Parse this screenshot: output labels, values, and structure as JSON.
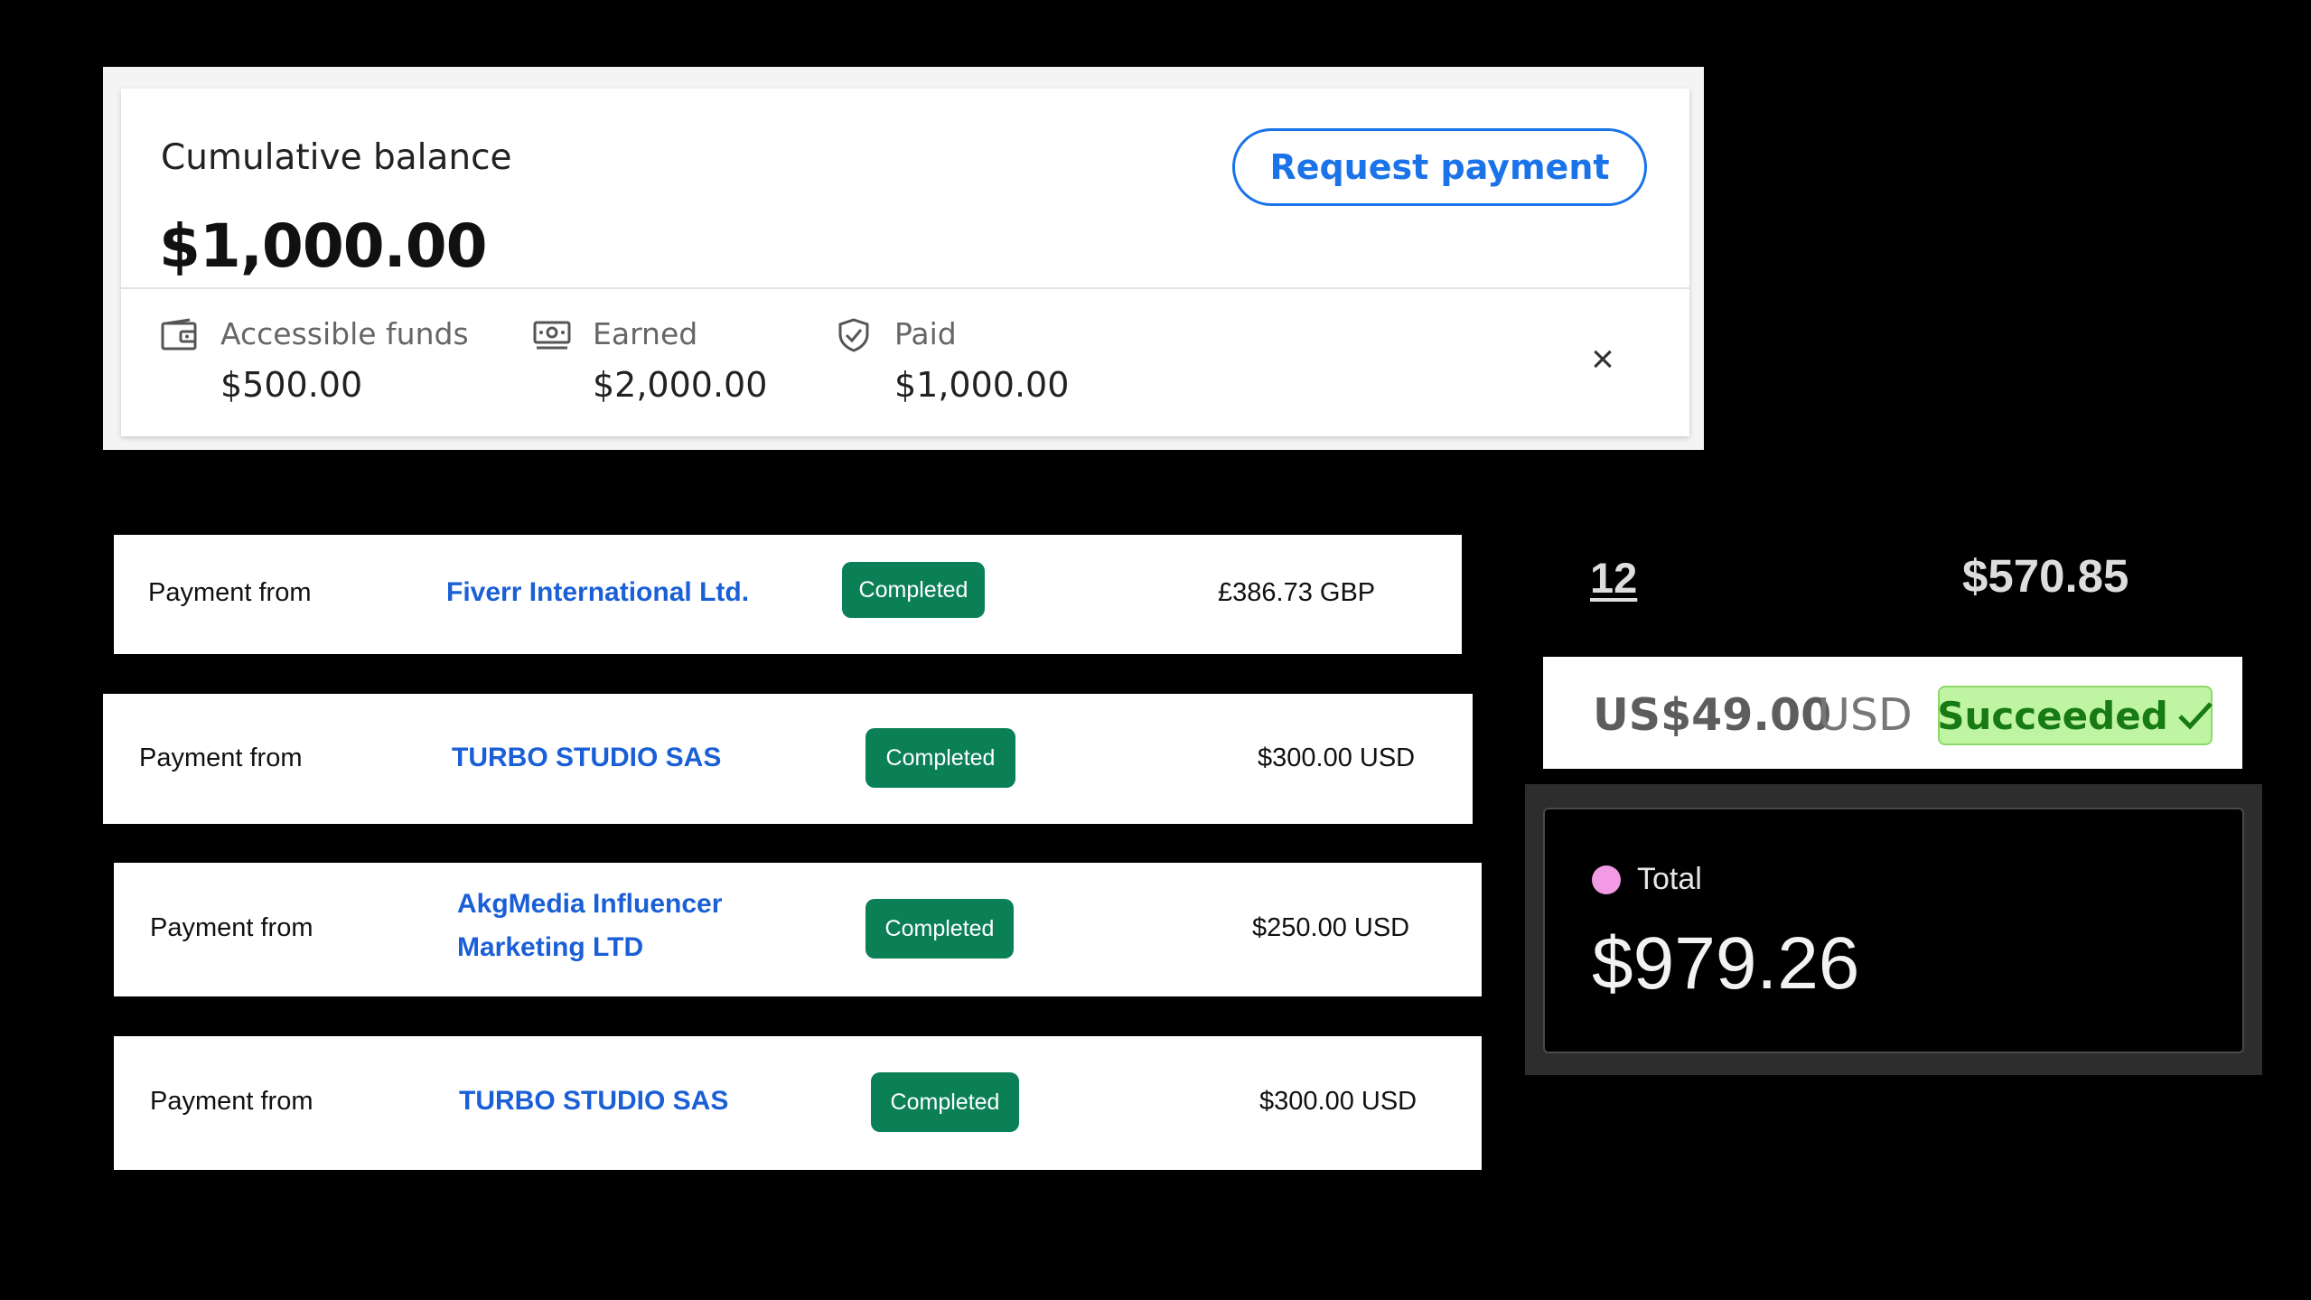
{
  "balance_card": {
    "title": "Cumulative balance",
    "amount": "$1,000.00",
    "request_button": "Request payment",
    "stats": [
      {
        "label": "Accessible funds",
        "value": "$500.00",
        "icon": "wallet-icon"
      },
      {
        "label": "Earned",
        "value": "$2,000.00",
        "icon": "cash-icon"
      },
      {
        "label": "Paid",
        "value": "$1,000.00",
        "icon": "shield-check-icon"
      }
    ],
    "close_icon": "close-icon",
    "accent_color": "#1a73e8"
  },
  "payments": [
    {
      "label": "Payment from",
      "payer": "Fiverr International Ltd.",
      "status": "Completed",
      "amount": "£386.73 GBP"
    },
    {
      "label": "Payment from",
      "payer": "TURBO STUDIO SAS",
      "status": "Completed",
      "amount": "$300.00 USD"
    },
    {
      "label": "Payment from",
      "payer": "AkgMedia Influencer Marketing LTD",
      "status": "Completed",
      "amount": "$250.00 USD"
    },
    {
      "label": "Payment from",
      "payer": "TURBO STUDIO SAS",
      "status": "Completed",
      "amount": "$300.00 USD"
    }
  ],
  "summary_row": {
    "count": "12",
    "price": "$570.85"
  },
  "usd_payment": {
    "amount": "US$49.00",
    "currency": "USD",
    "status": "Succeeded",
    "status_icon": "checkmark-icon"
  },
  "total": {
    "label": "Total",
    "value": "$979.26",
    "dot_color": "#f29ae4"
  },
  "colors": {
    "payer_link": "#1a5fd6",
    "completed_badge": "#0b8056",
    "succeeded_bg": "#bff5a2",
    "succeeded_text": "#177a13"
  }
}
